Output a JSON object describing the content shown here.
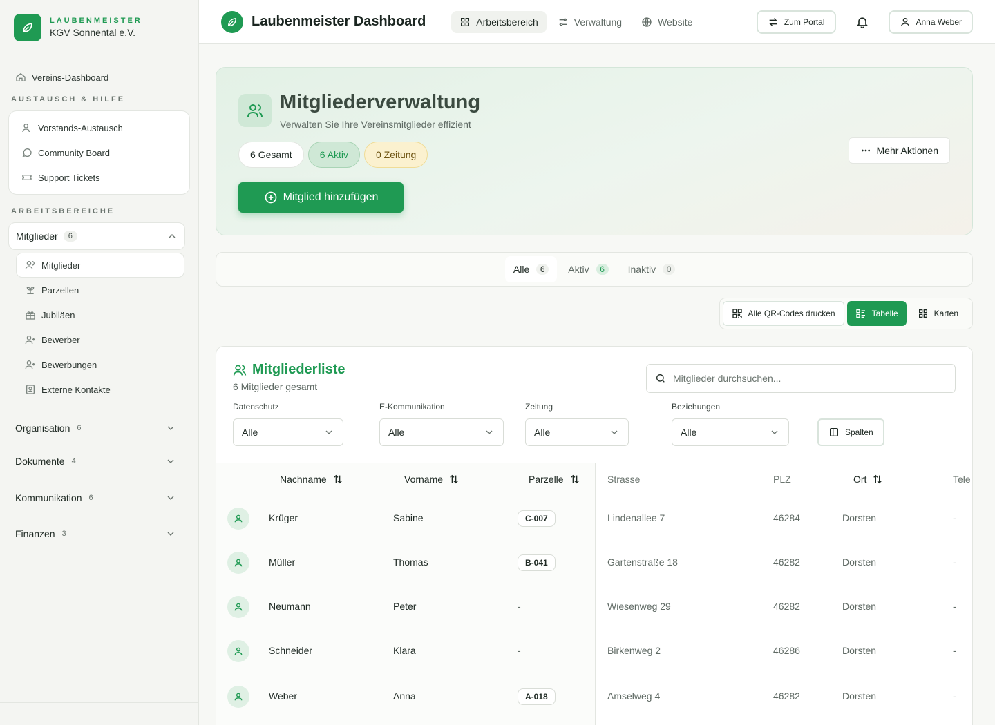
{
  "brand": {
    "kicker": "LAUBENMEISTER",
    "name": "KGV Sonnental e.V."
  },
  "sidebar": {
    "dashboard": "Vereins-Dashboard",
    "section_help": "AUSTAUSCH & HILFE",
    "help_items": [
      {
        "label": "Vorstands-Austausch",
        "icon": "users-icon"
      },
      {
        "label": "Community Board",
        "icon": "chat-bubble-icon"
      },
      {
        "label": "Support Tickets",
        "icon": "ticket-icon"
      }
    ],
    "section_work": "ARBEITSBEREICHE",
    "groups": [
      {
        "label": "Mitglieder",
        "count": "6",
        "expanded": true
      },
      {
        "label": "Organisation",
        "count": "6"
      },
      {
        "label": "Dokumente",
        "count": "4"
      },
      {
        "label": "Kommunikation",
        "count": "6"
      },
      {
        "label": "Finanzen",
        "count": "3"
      }
    ],
    "sub_items": [
      {
        "label": "Mitglieder",
        "icon": "users-icon",
        "active": true
      },
      {
        "label": "Parzellen",
        "icon": "sprout-icon"
      },
      {
        "label": "Jubiläen",
        "icon": "gift-icon"
      },
      {
        "label": "Bewerber",
        "icon": "user-plus-icon"
      },
      {
        "label": "Bewerbungen",
        "icon": "user-plus-icon"
      },
      {
        "label": "Externe Kontakte",
        "icon": "contact-card-icon"
      }
    ]
  },
  "topbar": {
    "title": "Laubenmeister Dashboard",
    "nav": [
      {
        "label": "Arbeitsbereich",
        "icon": "grid-icon",
        "active": true
      },
      {
        "label": "Verwaltung",
        "icon": "sliders-icon"
      },
      {
        "label": "Website",
        "icon": "globe-icon"
      }
    ],
    "portal_label": "Zum Portal",
    "user_name": "Anna Weber"
  },
  "hero": {
    "title": "Mitgliederverwaltung",
    "subtitle": "Verwalten Sie Ihre Vereinsmitglieder effizient",
    "stat_total": "6 Gesamt",
    "stat_active": "6 Aktiv",
    "stat_newspaper": "0 Zeitung",
    "add_label": "Mitglied hinzufügen",
    "more_label": "Mehr Aktionen"
  },
  "filter_tabs": [
    {
      "label": "Alle",
      "count": "6",
      "active": true
    },
    {
      "label": "Aktiv",
      "count": "6"
    },
    {
      "label": "Inaktiv",
      "count": "0"
    }
  ],
  "view": {
    "qr_label": "Alle QR-Codes drucken",
    "table_label": "Tabelle",
    "cards_label": "Karten"
  },
  "list": {
    "title": "Mitgliederliste",
    "subtitle": "6 Mitglieder gesamt",
    "search_placeholder": "Mitglieder durchsuchen...",
    "filters": [
      {
        "label": "Datenschutz",
        "value": "Alle"
      },
      {
        "label": "E-Kommunikation",
        "value": "Alle"
      },
      {
        "label": "Zeitung",
        "value": "Alle"
      },
      {
        "label": "Beziehungen",
        "value": "Alle"
      }
    ],
    "columns_label": "Spalten",
    "headers": {
      "nachname": "Nachname",
      "vorname": "Vorname",
      "parzelle": "Parzelle",
      "strasse": "Strasse",
      "plz": "PLZ",
      "ort": "Ort",
      "telefon": "Tele"
    },
    "rows": [
      {
        "nachname": "Krüger",
        "vorname": "Sabine",
        "parzelle": "C-007",
        "strasse": "Lindenallee 7",
        "plz": "46284",
        "ort": "Dorsten",
        "telefon": "-"
      },
      {
        "nachname": "Müller",
        "vorname": "Thomas",
        "parzelle": "B-041",
        "strasse": "Gartenstraße 18",
        "plz": "46282",
        "ort": "Dorsten",
        "telefon": "-"
      },
      {
        "nachname": "Neumann",
        "vorname": "Peter",
        "parzelle": "-",
        "strasse": "Wiesenweg 29",
        "plz": "46282",
        "ort": "Dorsten",
        "telefon": "-"
      },
      {
        "nachname": "Schneider",
        "vorname": "Klara",
        "parzelle": "-",
        "strasse": "Birkenweg 2",
        "plz": "46286",
        "ort": "Dorsten",
        "telefon": "-"
      },
      {
        "nachname": "Weber",
        "vorname": "Anna",
        "parzelle": "A-018",
        "strasse": "Amselweg 4",
        "plz": "46282",
        "ort": "Dorsten",
        "telefon": "-"
      }
    ]
  },
  "colors": {
    "accent": "#1f9a53",
    "accent_soft": "#cfe8d6",
    "warning_soft": "#fbf1cf"
  }
}
